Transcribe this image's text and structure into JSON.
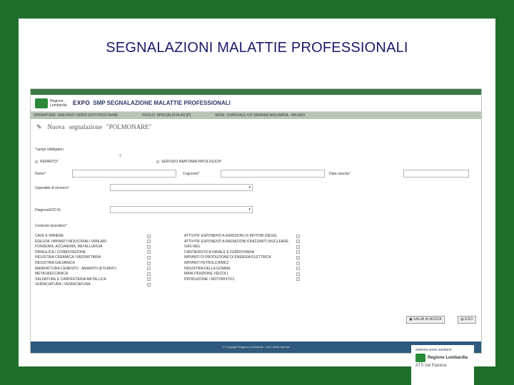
{
  "slide": {
    "title": "SEGNALAZIONI MALATTIE PROFESSIONALI"
  },
  "brand": {
    "region_lines": "Regione Lombardia",
    "expo": "EXPO",
    "app_title": "SMP SEGNALAZIONE MALATTIE PROFESSIONALI"
  },
  "opbar": {
    "operator": "OPERATORE: GAETANO VERDI SSPV7RCG7A44E",
    "role": "RUOLO: SPECIALISTA AO [P]",
    "site": "SEDE: OSPEDALE CA' GRANDA NIGUARDA - MILANO"
  },
  "form": {
    "title_prefix": "Nuova",
    "title_mid": "segnalazione",
    "title_quoted": "\"POLMONARE\"",
    "required_note": "*campi obbligatori",
    "reparto_label": "REPARTO*",
    "servizio_label": "SERVIZIO ANATOMIA PATOLOGICA*",
    "nome_label": "Nome*",
    "cognome_label": "Cognome*",
    "nascita_label": "Data nascita*",
    "ospedale_label": "Ospedale di ricovero*",
    "diagnosi_label": "Diagnosi(ICD-9)",
    "contesto_label": "Contesto lavorativo*",
    "select_arrow": "▾",
    "contesti_left": [
      "CAVE E MINIERE",
      "EDILIZIA, IMPIANTI INDUSTRIALI SIMILARI",
      "FONDERIA, ACCIAIERIA, METALLURGIA",
      "IDRAULICA / COIBENTAZIONE",
      "INDUSTRIA CERAMICA / REFRATTARIA",
      "INDUSTRIA GALVANICA",
      "MANIFATTURA CEMENTO - AMIANTO (ETERNIT)",
      "METALMECCANICA",
      "SALDATURE E CARPENTERIA METALLICA",
      "VERNICIATURA / VERNICIATURA"
    ],
    "contesti_right": [
      "ATTIVITA' ESPONENTI A EMISSIONI DI MOTORI DIESEL",
      "ATTIVITA' ESPONENTI A RADIAZIONI IONIZZANTI (NUCLEARE",
      "GAS NEI)",
      "CANTIERISTICA NAVALE E FERROVIARIA",
      "IMPIANTI DI PRODUZIONE DI ENERGIA ELETTRICA",
      "IMPIANTI PETROLCHIMICI",
      "INDUSTRIA DELLA GOMMA",
      "MANUTENZIONE VEICOLI",
      "PRODUZIONE / MOTORISTICI"
    ]
  },
  "actions": {
    "save_label": "SALVA IN BOZZA",
    "exit_label": "ESCI"
  },
  "footer": {
    "text": "© Copyright Regione Lombardia - tutti i diritti riservati"
  },
  "badge": {
    "top_text": "sistema socio sanitario",
    "region": "Regione Lombardia",
    "sub": "ATS Val Padana"
  }
}
